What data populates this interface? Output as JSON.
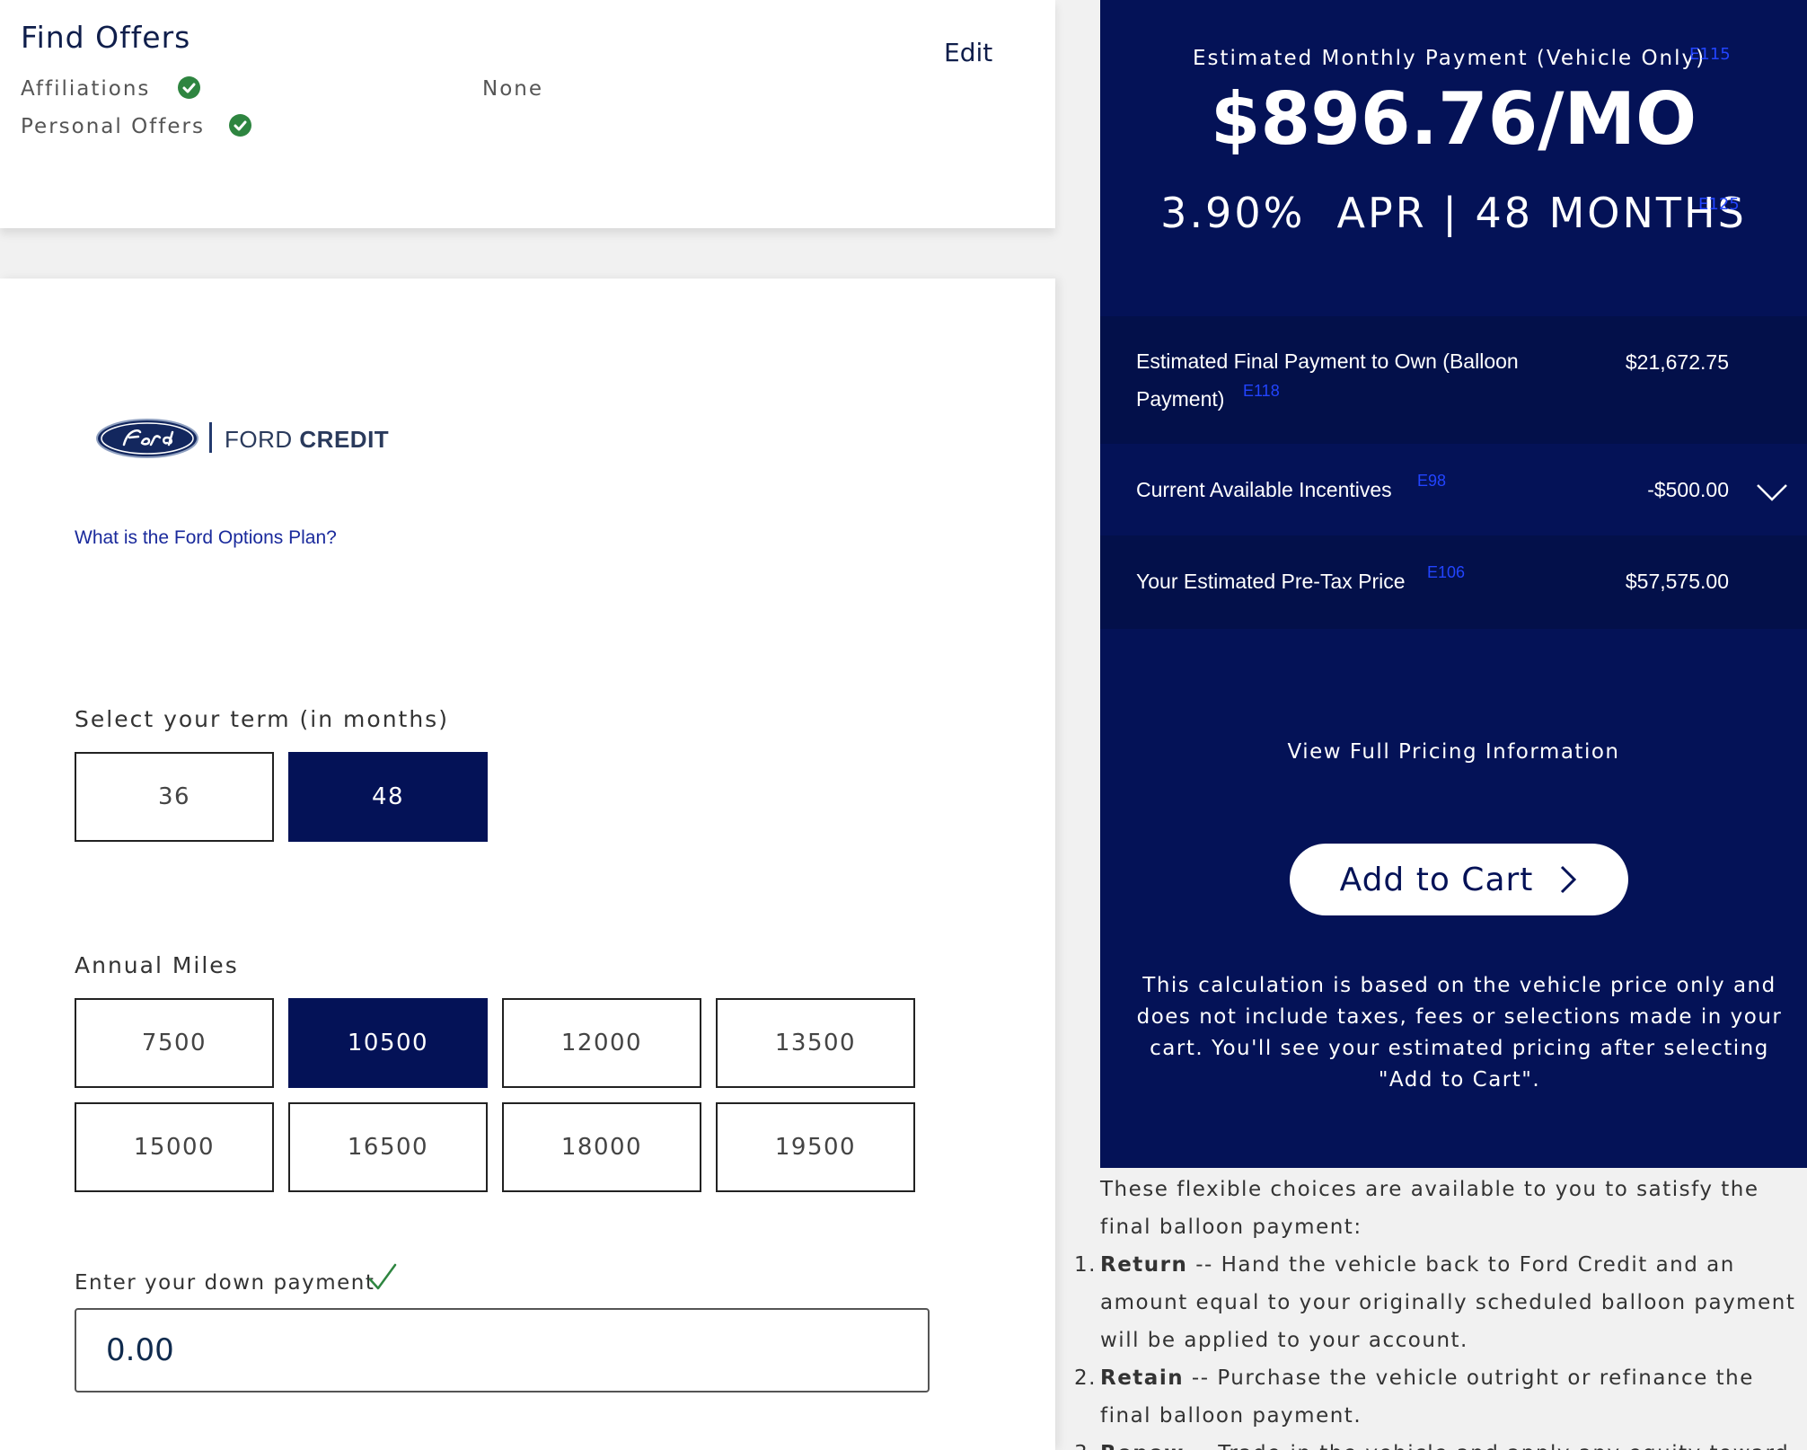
{
  "find_offers": {
    "title": "Find Offers",
    "edit_label": "Edit",
    "affiliations_label": "Affiliations",
    "personal_offers_label": "Personal Offers",
    "affiliations_value": "None"
  },
  "plan": {
    "brand_name_regular": "FORD",
    "brand_name_bold": "CREDIT",
    "options_link": "What is the Ford Options Plan?",
    "term_label": "Select your term (in months)",
    "terms": [
      {
        "label": "36",
        "selected": false
      },
      {
        "label": "48",
        "selected": true
      }
    ],
    "miles_label": "Annual Miles",
    "miles": [
      {
        "label": "7500",
        "selected": false
      },
      {
        "label": "10500",
        "selected": true
      },
      {
        "label": "12000",
        "selected": false
      },
      {
        "label": "13500",
        "selected": false
      },
      {
        "label": "15000",
        "selected": false
      },
      {
        "label": "16500",
        "selected": false
      },
      {
        "label": "18000",
        "selected": false
      },
      {
        "label": "19500",
        "selected": false
      }
    ],
    "down_payment_label": "Enter your down payment",
    "down_payment_value": "0.00"
  },
  "summary": {
    "estimated_label": "Estimated Monthly Payment (Vehicle Only)",
    "estimated_ref": "E115",
    "monthly_amount": "$896.76/MO",
    "apr_line": "3.90%  APR | 48 MONTHS",
    "apr_ref": "E125",
    "rows": [
      {
        "label": "Estimated Final Payment to Own (Balloon Payment)",
        "ref": "E118",
        "value": "$21,672.75"
      },
      {
        "label": "Current Available Incentives",
        "ref": "E98",
        "value": "-$500.00"
      },
      {
        "label": "Your Estimated Pre-Tax Price",
        "ref": "E106",
        "value": "$57,575.00"
      }
    ],
    "view_pricing": "View Full Pricing Information",
    "add_to_cart": "Add to Cart",
    "calc_note": "This calculation is based on the vehicle price only and does not include taxes, fees or selections made in your cart. You'll see your estimated pricing after selecting \"Add to Cart\"."
  },
  "balloon_choices": {
    "intro": "These flexible choices are available to you to satisfy the final balloon payment:",
    "items": [
      {
        "num": "1.",
        "title": "Return",
        "text": " -- Hand the vehicle back to Ford Credit and an amount equal to your originally scheduled balloon payment will be applied to your account."
      },
      {
        "num": "2.",
        "title": "Retain",
        "text": " -- Purchase the vehicle outright or refinance the final balloon payment."
      },
      {
        "num": "3.",
        "title": "Renew",
        "text": " -- Trade-in the vehicle and apply any equity toward the"
      }
    ]
  },
  "colors": {
    "navy": "#041257",
    "check_green": "#2e8540",
    "ref_blue": "#2244ff",
    "link_blue": "#1a2a9c"
  }
}
